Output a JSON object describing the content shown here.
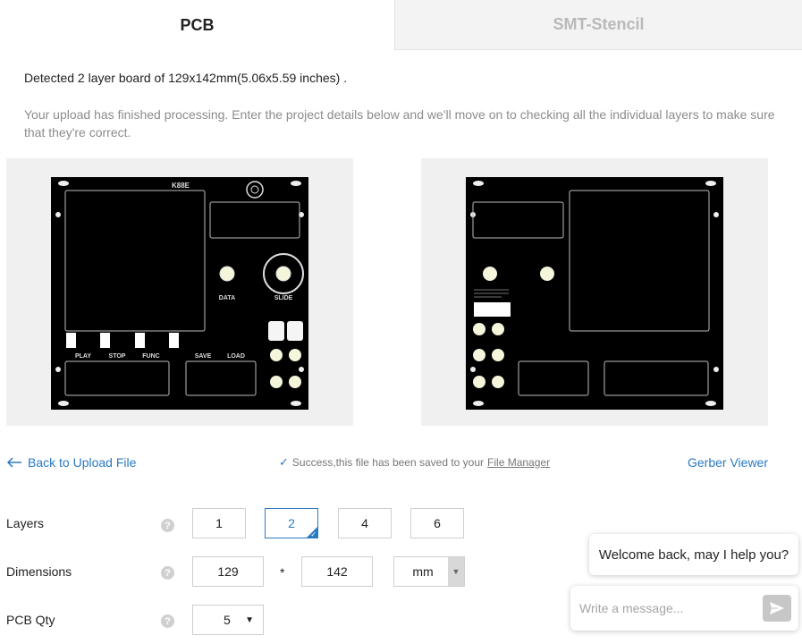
{
  "tabs": [
    {
      "label": "PCB",
      "active": true
    },
    {
      "label": "SMT-Stencil",
      "active": false
    }
  ],
  "detected_text": "Detected 2 layer board of 129x142mm(5.06x5.59 inches) .",
  "processing_text": "Your upload has finished processing. Enter the project details below and we'll move on to checking all the individual layers to make sure that they're correct.",
  "board_top": {
    "title": "K88E",
    "labels": [
      "DATA",
      "SLIDE",
      "PLAY",
      "STOP",
      "FUNC",
      "SAVE",
      "LOAD"
    ]
  },
  "back_link": "Back to Upload File",
  "success": {
    "text": "Success,this file has been saved to your",
    "link": "File Manager"
  },
  "gerber_link": "Gerber Viewer",
  "layers": {
    "label": "Layers",
    "options": [
      "1",
      "2",
      "4",
      "6"
    ],
    "selected": "2"
  },
  "dimensions": {
    "label": "Dimensions",
    "width": "129",
    "separator": "*",
    "height": "142",
    "unit": "mm"
  },
  "pcb_qty": {
    "label": "PCB Qty",
    "value": "5"
  },
  "help_glyph": "?",
  "chat": {
    "greeting": "Welcome back, may I help you?",
    "placeholder": "Write a message..."
  },
  "colors": {
    "accent": "#2a7ac0",
    "tab_inactive_bg": "#f3f3f3",
    "preview_bg": "#f0f0f0"
  }
}
